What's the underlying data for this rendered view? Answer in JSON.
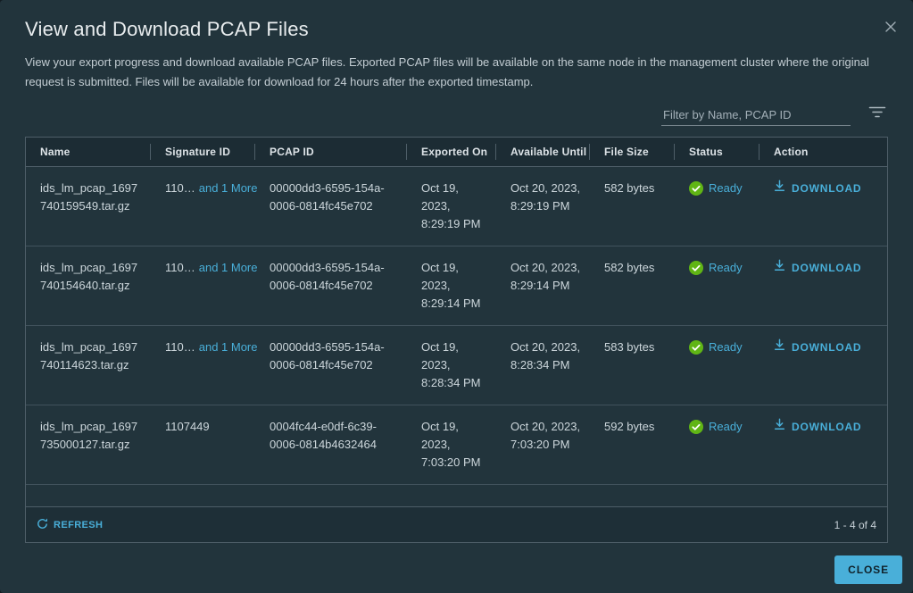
{
  "modal": {
    "title": "View and Download PCAP Files",
    "description": "View your export progress and download available PCAP files. Exported PCAP files will be available on the same node in the management cluster where the original request is submitted. Files will be available for download for 24 hours after the exported timestamp.",
    "close_button_label": "CLOSE"
  },
  "filter": {
    "placeholder": "Filter by Name, PCAP ID",
    "icon": "filter-icon"
  },
  "table": {
    "columns": [
      "Name",
      "Signature ID",
      "PCAP ID",
      "Exported On",
      "Available Until",
      "File Size",
      "Status",
      "Action"
    ],
    "rows": [
      {
        "name": "ids_lm_pcap_1697740159549.tar.gz",
        "signature_id": "110…",
        "signature_more": "and 1 More",
        "pcap_id": "00000dd3-6595-154a-0006-0814fc45e702",
        "exported_on": "Oct 19, 2023, 8:29:19 PM",
        "available_until": "Oct 20, 2023, 8:29:19 PM",
        "file_size": "582 bytes",
        "status": "Ready",
        "action": "DOWNLOAD"
      },
      {
        "name": "ids_lm_pcap_1697740154640.tar.gz",
        "signature_id": "110…",
        "signature_more": "and 1 More",
        "pcap_id": "00000dd3-6595-154a-0006-0814fc45e702",
        "exported_on": "Oct 19, 2023, 8:29:14 PM",
        "available_until": "Oct 20, 2023, 8:29:14 PM",
        "file_size": "582 bytes",
        "status": "Ready",
        "action": "DOWNLOAD"
      },
      {
        "name": "ids_lm_pcap_1697740114623.tar.gz",
        "signature_id": "110…",
        "signature_more": "and 1 More",
        "pcap_id": "00000dd3-6595-154a-0006-0814fc45e702",
        "exported_on": "Oct 19, 2023, 8:28:34 PM",
        "available_until": "Oct 20, 2023, 8:28:34 PM",
        "file_size": "583 bytes",
        "status": "Ready",
        "action": "DOWNLOAD"
      },
      {
        "name": "ids_lm_pcap_1697735000127.tar.gz",
        "signature_id": "1107449",
        "signature_more": "",
        "pcap_id": "0004fc44-e0df-6c39-0006-0814b4632464",
        "exported_on": "Oct 19, 2023, 7:03:20 PM",
        "available_until": "Oct 20, 2023, 7:03:20 PM",
        "file_size": "592 bytes",
        "status": "Ready",
        "action": "DOWNLOAD"
      }
    ],
    "footer": {
      "refresh_label": "REFRESH",
      "range_label": "1 - 4 of 4"
    }
  },
  "colors": {
    "accent_blue": "#49afd9",
    "success_green": "#60b515",
    "modal_bg": "#22343c",
    "grid_header_bg": "#1c2c34",
    "close_button_text": "#10222b"
  }
}
